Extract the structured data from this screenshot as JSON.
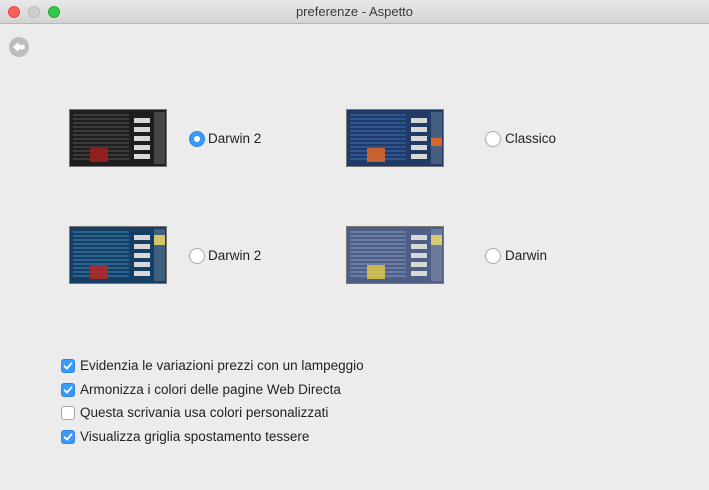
{
  "window": {
    "title": "preferenze - Aspetto"
  },
  "themes": [
    {
      "label": "Darwin 2",
      "selected": true,
      "thumb_bg": "#1e1e1e",
      "thumb_accent": "#9a2020",
      "thumb_row": "#3a3a3a"
    },
    {
      "label": "Classico",
      "selected": false,
      "thumb_bg": "#1f3b66",
      "thumb_accent": "#d9662a",
      "thumb_row": "#2f5690"
    },
    {
      "label": "Darwin 2",
      "selected": false,
      "thumb_bg": "#163e63",
      "thumb_accent": "#b02828",
      "thumb_row": "#2a6490"
    },
    {
      "label": "Darwin",
      "selected": false,
      "thumb_bg": "#4e5f86",
      "thumb_accent": "#d8c04a",
      "thumb_row": "#6b7ca6"
    }
  ],
  "options": [
    {
      "label": "Evidenzia le variazioni prezzi con un lampeggio",
      "checked": true
    },
    {
      "label": "Armonizza i colori delle pagine Web Directa",
      "checked": true
    },
    {
      "label": "Questa scrivania usa colori personalizzati",
      "checked": false
    },
    {
      "label": "Visualizza griglia spostamento tessere",
      "checked": true
    }
  ],
  "colors": {
    "accent": "#3b99fc",
    "window_bg": "#ececec"
  }
}
